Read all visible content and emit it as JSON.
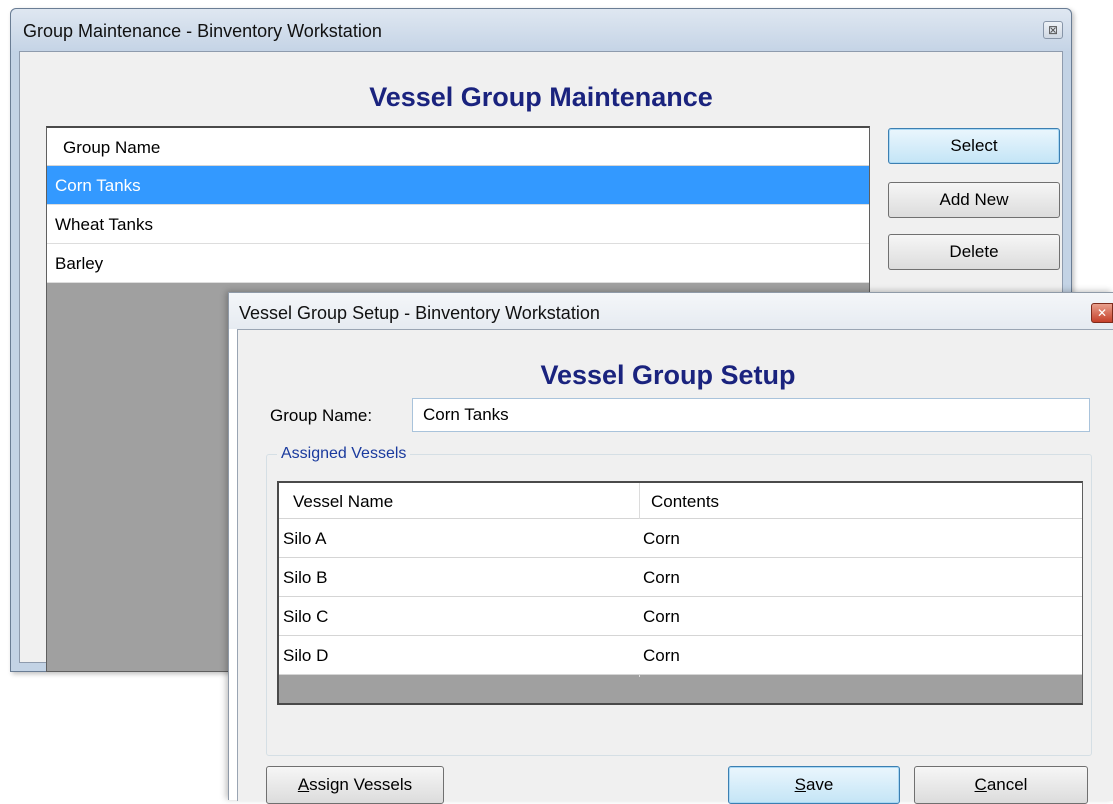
{
  "group_maintenance": {
    "title": "Group Maintenance - Binventory Workstation",
    "close_glyph": "⊠",
    "heading": "Vessel Group Maintenance",
    "list": {
      "column_header": "Group Name",
      "rows": [
        {
          "name": "Corn Tanks",
          "selected": true
        },
        {
          "name": "Wheat Tanks",
          "selected": false
        },
        {
          "name": "Barley",
          "selected": false
        }
      ]
    },
    "buttons": {
      "select": "Select",
      "add_new": "Add New",
      "delete": "Delete"
    }
  },
  "vessel_group_setup": {
    "title": "Vessel Group Setup - Binventory Workstation",
    "close_glyph": "✕",
    "heading": "Vessel Group Setup",
    "group_name_label": "Group Name:",
    "group_name_value": "Corn Tanks",
    "assigned_vessels_label": "Assigned Vessels",
    "grid": {
      "columns": [
        "Vessel Name",
        "Contents"
      ],
      "rows": [
        {
          "vessel": "Silo A",
          "contents": "Corn"
        },
        {
          "vessel": "Silo B",
          "contents": "Corn"
        },
        {
          "vessel": "Silo C",
          "contents": "Corn"
        },
        {
          "vessel": "Silo D",
          "contents": "Corn"
        }
      ]
    },
    "buttons": {
      "assign_vessels": "Assign Vessels",
      "save": "Save",
      "cancel": "Cancel"
    }
  },
  "colors": {
    "heading": "#1a237e",
    "selection": "#3399ff",
    "groupbox_legend": "#1a3a9e"
  }
}
